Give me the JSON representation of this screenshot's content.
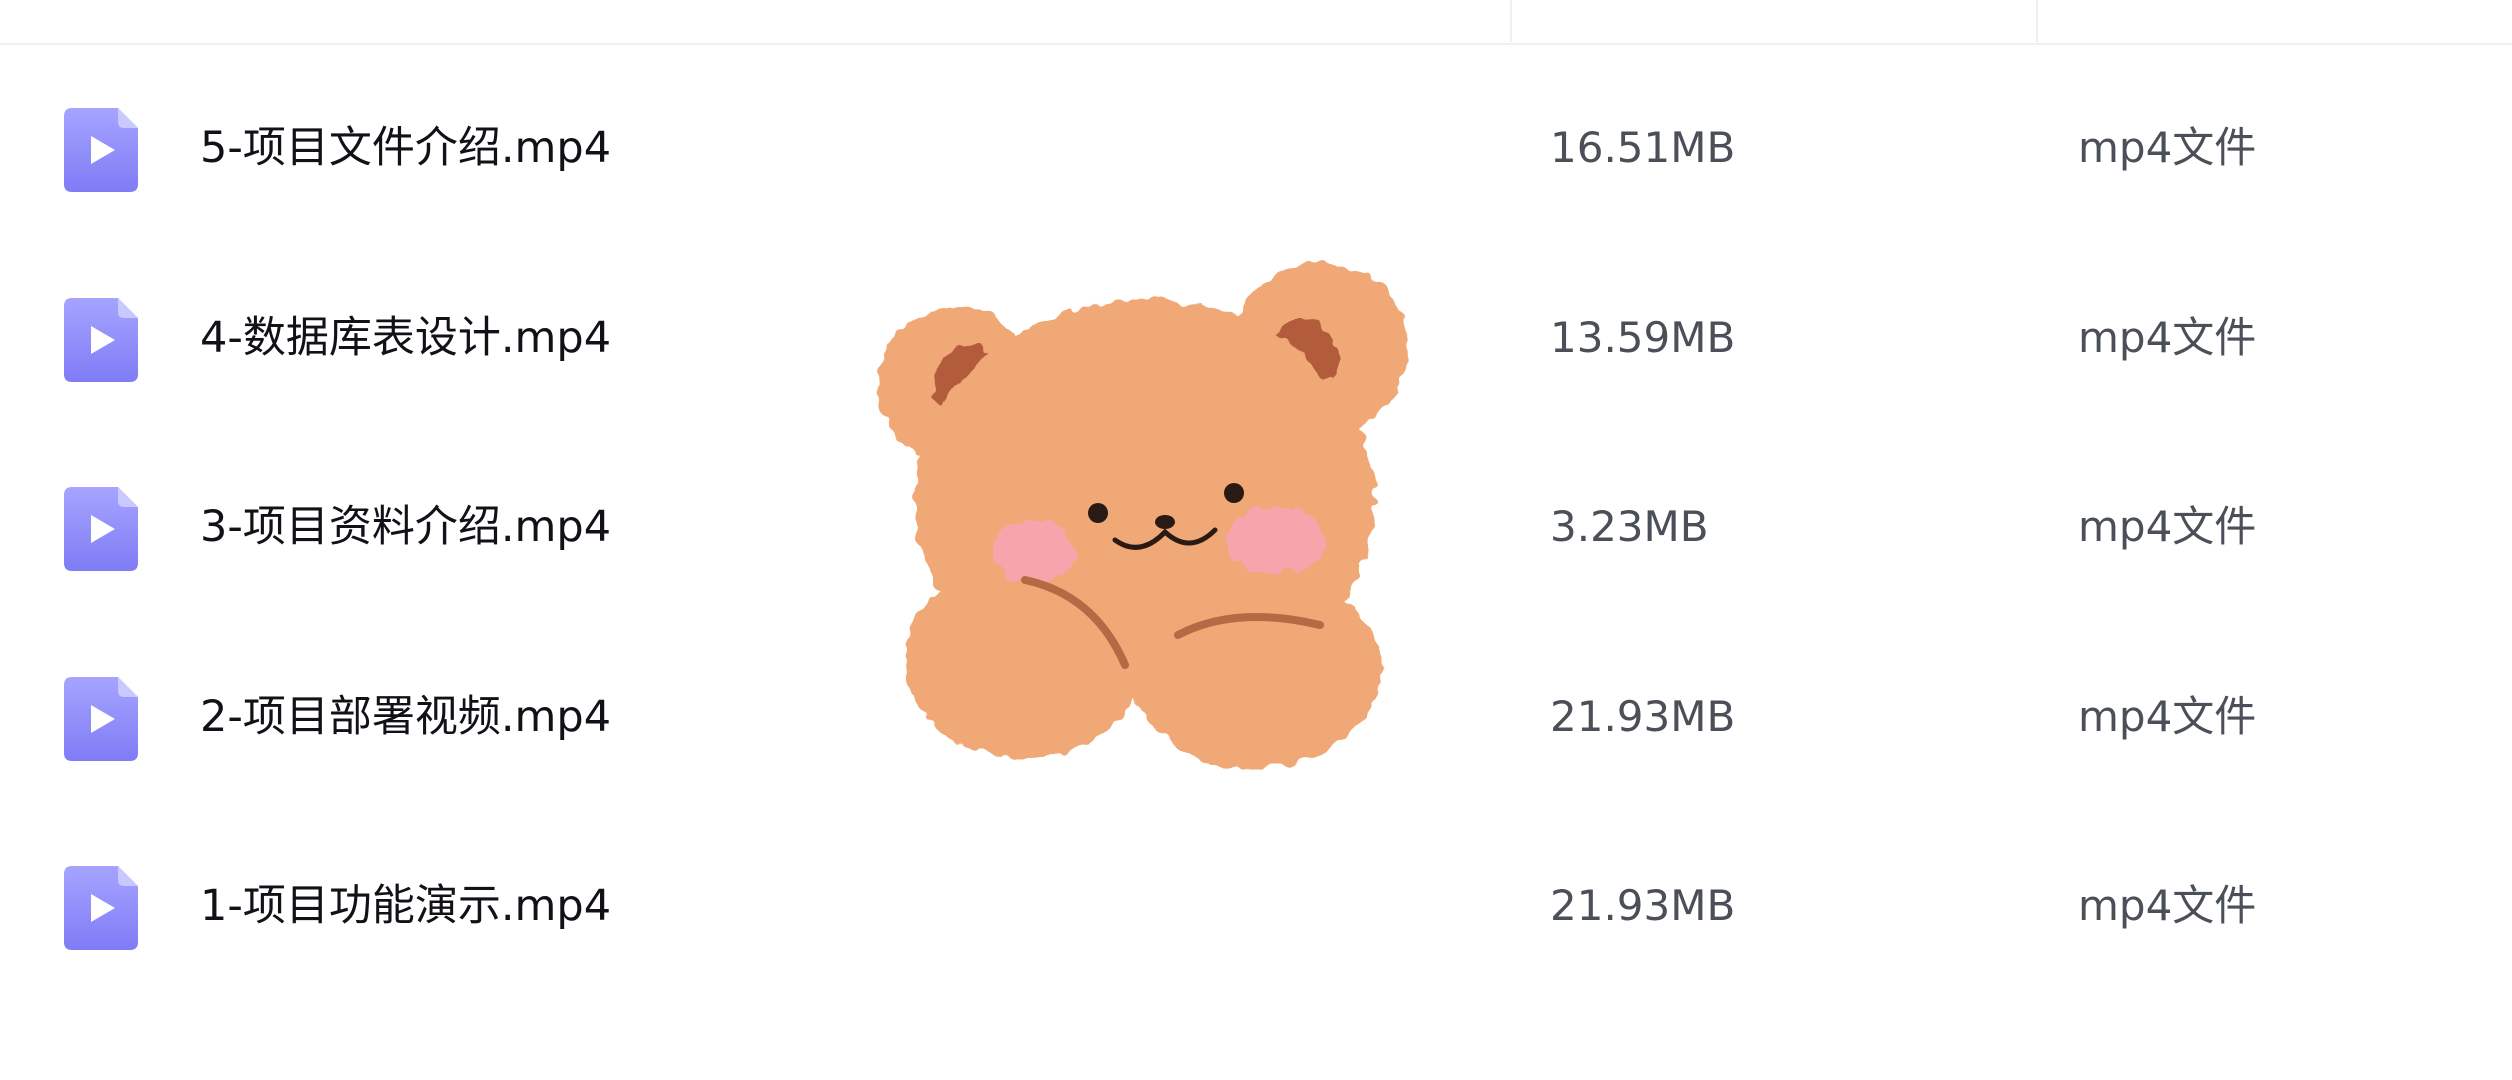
{
  "files": [
    {
      "name": "5-项目文件介绍.mp4",
      "size": "16.51MB",
      "type": "mp4文件",
      "icon": "video-file-icon"
    },
    {
      "name": "4-数据库表设计.mp4",
      "size": "13.59MB",
      "type": "mp4文件",
      "icon": "video-file-icon"
    },
    {
      "name": "3-项目资料介绍.mp4",
      "size": "3.23MB",
      "type": "mp4文件",
      "icon": "video-file-icon"
    },
    {
      "name": "2-项目部署视频.mp4",
      "size": "21.93MB",
      "type": "mp4文件",
      "icon": "video-file-icon"
    },
    {
      "name": "1-项目功能演示.mp4",
      "size": "21.93MB",
      "type": "mp4文件",
      "icon": "video-file-icon"
    }
  ],
  "colors": {
    "icon_top": "#a6a4ff",
    "icon_bottom": "#7f7cf6",
    "bear_fur": "#f0a877",
    "bear_ear": "#b25c3b",
    "bear_cheek": "#f6a5ad"
  }
}
